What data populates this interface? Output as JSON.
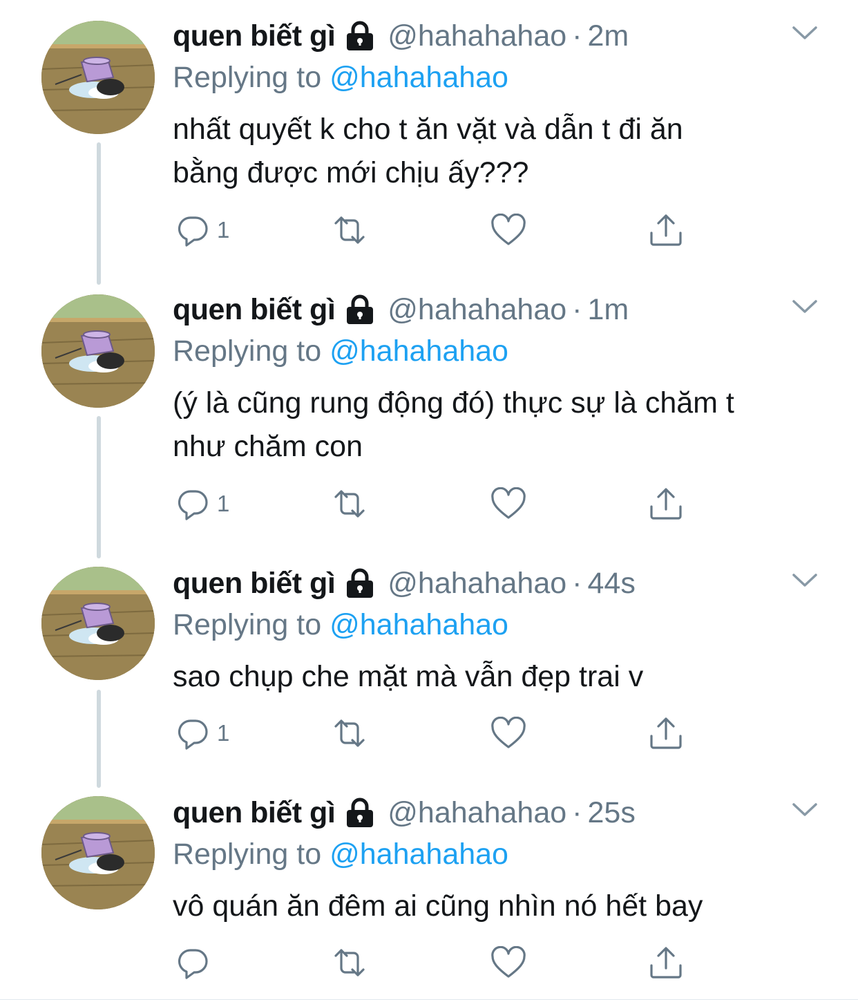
{
  "tweets": [
    {
      "display_name": "quen biết gì",
      "handle": "@hahahahao",
      "time": "2m",
      "replying_prefix": "Replying to",
      "replying_handle": "@hahahahao",
      "text_lines": [
        "nhất quyết k cho t ăn vặt và dẫn t đi ăn",
        "bằng được mới chịu ấy???"
      ],
      "reply_count": "1"
    },
    {
      "display_name": "quen biết gì",
      "handle": "@hahahahao",
      "time": "1m",
      "replying_prefix": "Replying to",
      "replying_handle": "@hahahahao",
      "text_lines": [
        "(ý là cũng rung động đó) thực sự là chăm t",
        "như chăm con"
      ],
      "reply_count": "1"
    },
    {
      "display_name": "quen biết gì",
      "handle": "@hahahahao",
      "time": "44s",
      "replying_prefix": "Replying to",
      "replying_handle": "@hahahahao",
      "text_lines": [
        "sao chụp che mặt mà vẫn đẹp trai v"
      ],
      "reply_count": "1"
    },
    {
      "display_name": "quen biết gì",
      "handle": "@hahahahao",
      "time": "25s",
      "replying_prefix": "Replying to",
      "replying_handle": "@hahahahao",
      "text_lines": [
        "vô quán ăn đêm ai cũng nhìn nó hết bay"
      ],
      "reply_count": ""
    }
  ],
  "icons": {
    "avatar": "avatar-image",
    "lock": "lock-icon",
    "caret": "chevron-down-icon",
    "reply": "reply-icon",
    "retweet": "retweet-icon",
    "like": "heart-icon",
    "share": "share-icon"
  },
  "colors": {
    "link": "#1da1f2",
    "secondary_text": "#657786",
    "thread_line": "#cfd9de"
  }
}
